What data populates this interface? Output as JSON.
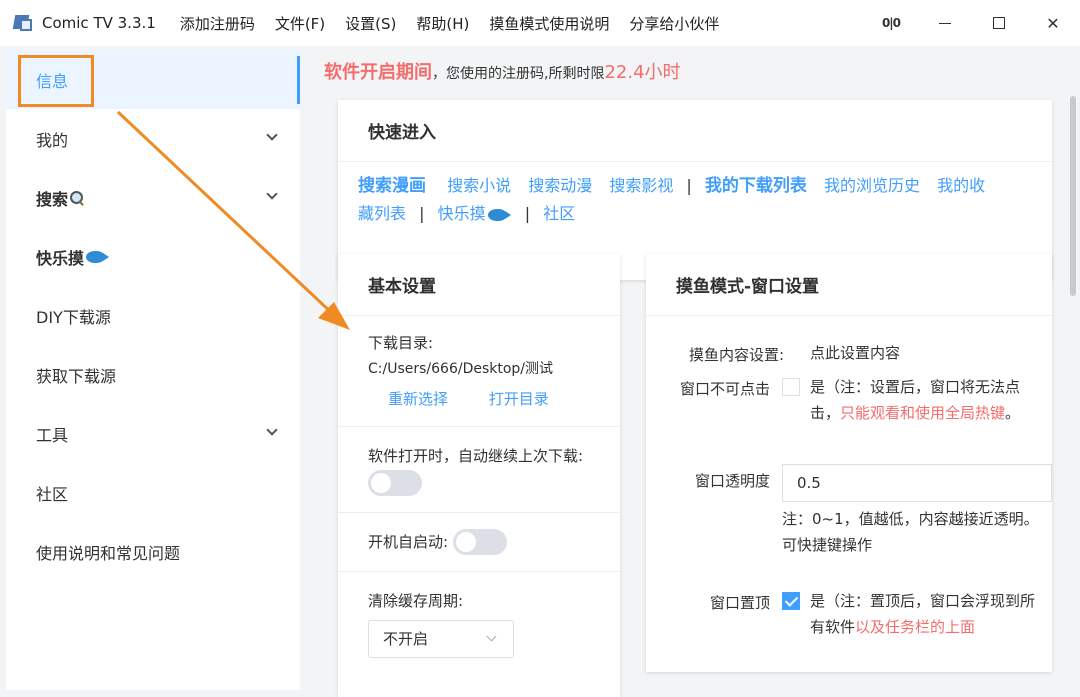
{
  "window": {
    "title": "Comic TV 3.3.1",
    "menu": [
      "添加注册码",
      "文件(F)",
      "设置(S)",
      "帮助(H)",
      "摸鱼模式使用说明",
      "分享给小伙伴"
    ],
    "controls": {
      "pin": "0|0",
      "close": "✕"
    }
  },
  "sidebar": {
    "items": [
      {
        "label": "信息"
      },
      {
        "label": "我的"
      },
      {
        "label": "搜索"
      },
      {
        "label": "快乐摸"
      },
      {
        "label": "DIY下载源"
      },
      {
        "label": "获取下载源"
      },
      {
        "label": "工具"
      },
      {
        "label": "社区"
      },
      {
        "label": "使用说明和常见问题"
      }
    ]
  },
  "notice": {
    "part1": "软件开启期间",
    "part2": "，您使用的注册码,所剩时限",
    "part3": "22.4小时"
  },
  "quick_entry": {
    "title": "快速进入",
    "links_row1": [
      "搜索漫画",
      "搜索小说",
      "搜索动漫",
      "搜索影视",
      "我的下载列表",
      "我的浏览历史",
      "我的收"
    ],
    "links_row2": [
      "藏列表",
      "快乐摸",
      "社区"
    ],
    "separator": "|"
  },
  "basic_settings": {
    "title": "基本设置",
    "download_dir_label": "下载目录:",
    "download_dir_value": "C:/Users/666/Desktop/测试",
    "reselect": "重新选择",
    "open_dir": "打开目录",
    "auto_continue_label": "软件打开时，自动继续上次下载:",
    "autostart_label": "开机自启动:",
    "cache_period_label": "清除缓存周期:",
    "cache_period_value": "不开启"
  },
  "window_settings": {
    "title": "摸鱼模式-窗口设置",
    "content_label": "摸鱼内容设置:",
    "content_link": "点此设置内容",
    "unclickable_label": "窗口不可点击",
    "unclickable_text": "是（注：设置后，窗口将无法点击，",
    "unclickable_red": "只能观看和使用全局热键",
    "unclickable_end": "。",
    "opacity_label": "窗口透明度",
    "opacity_value": "0.5",
    "opacity_note": "注：0~1，值越低，内容越接近透明。可快捷键操作",
    "ontop_label": "窗口置顶",
    "ontop_text": "是（注：置顶后，窗口会浮现到所有软件",
    "ontop_red": "以及任务栏的上面"
  },
  "colors": {
    "accent": "#409eff",
    "red": "#f56c6c",
    "annotation": "#f08a24"
  }
}
